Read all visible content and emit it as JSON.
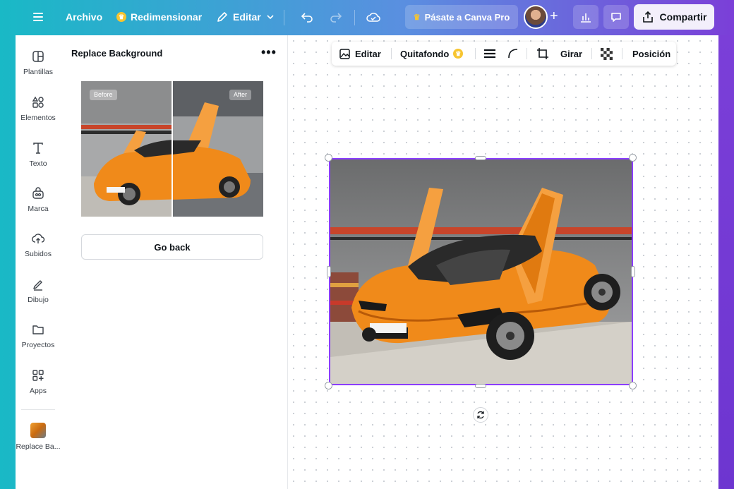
{
  "topbar": {
    "file_label": "Archivo",
    "resize_label": "Redimensionar",
    "edit_label": "Editar",
    "pro_label": "Pásate a Canva Pro",
    "share_label": "Compartir"
  },
  "rail": {
    "items": [
      {
        "label": "Plantillas"
      },
      {
        "label": "Elementos"
      },
      {
        "label": "Texto"
      },
      {
        "label": "Marca"
      },
      {
        "label": "Subidos"
      },
      {
        "label": "Dibujo"
      },
      {
        "label": "Proyectos"
      },
      {
        "label": "Apps"
      },
      {
        "label": "Replace Ba..."
      }
    ]
  },
  "panel": {
    "title": "Replace Background",
    "preview_before": "Before",
    "preview_after": "After",
    "go_back": "Go back"
  },
  "context_toolbar": {
    "edit": "Editar",
    "bg_remover": "Quitafondo",
    "rotate": "Girar",
    "position": "Posición"
  },
  "colors": {
    "selection": "#8b3dff",
    "car": "#f08a1a",
    "pro_crown": "#f7c531"
  }
}
